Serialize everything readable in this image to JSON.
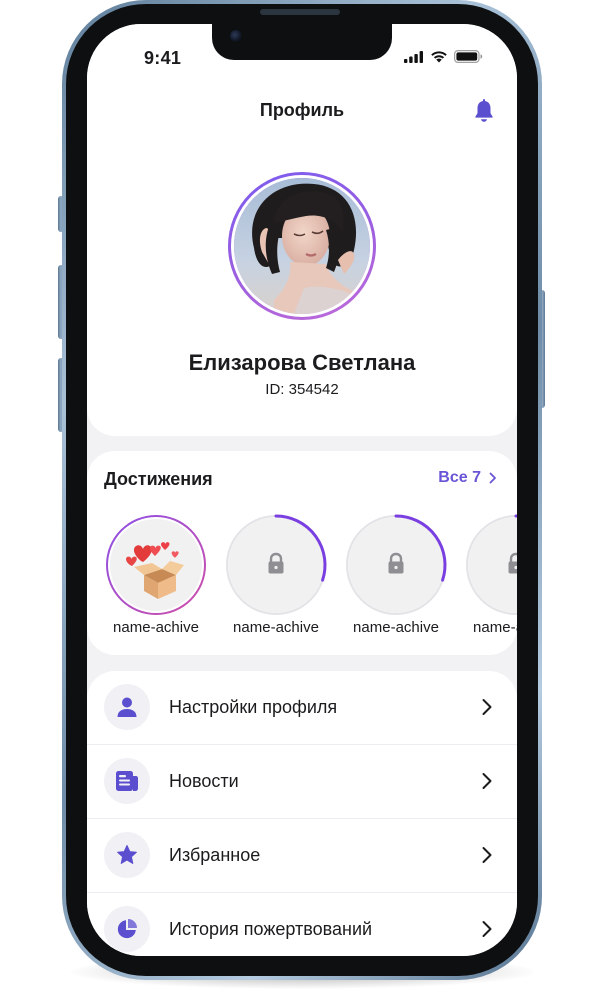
{
  "status_bar": {
    "time": "9:41",
    "icons": [
      "signal-icon",
      "wifi-icon",
      "battery-icon"
    ]
  },
  "header": {
    "title": "Профиль",
    "notification_icon": "bell-icon"
  },
  "profile": {
    "name": "Елизарова Светлана",
    "id_text": "ID: 354542"
  },
  "achievements": {
    "title": "Достижения",
    "all_label": "Все 7",
    "items": [
      {
        "label": "name-achive",
        "state": "unlocked",
        "icon": "gift-box-hearts-icon",
        "progress": 1.0
      },
      {
        "label": "name-achive",
        "state": "locked",
        "icon": "lock-icon",
        "progress": 0.3
      },
      {
        "label": "name-achive",
        "state": "locked",
        "icon": "lock-icon",
        "progress": 0.3
      },
      {
        "label": "name-achive",
        "state": "locked",
        "icon": "lock-icon",
        "progress": 0.3
      }
    ]
  },
  "menu": {
    "items": [
      {
        "label": "Настройки профиля",
        "icon": "user-icon"
      },
      {
        "label": "Новости",
        "icon": "newspaper-icon"
      },
      {
        "label": "Избранное",
        "icon": "star-icon"
      },
      {
        "label": "История пожертвований",
        "icon": "pie-chart-icon"
      }
    ]
  },
  "colors": {
    "accent": "#6a55d6",
    "icon_purple": "#5b4fd0",
    "avatar_ring_start": "#7b5cf0",
    "avatar_ring_end": "#c06bd8",
    "screen_background": "#f2f2f5",
    "card_background": "#ffffff",
    "locked_circle": "#f1f1f1"
  }
}
